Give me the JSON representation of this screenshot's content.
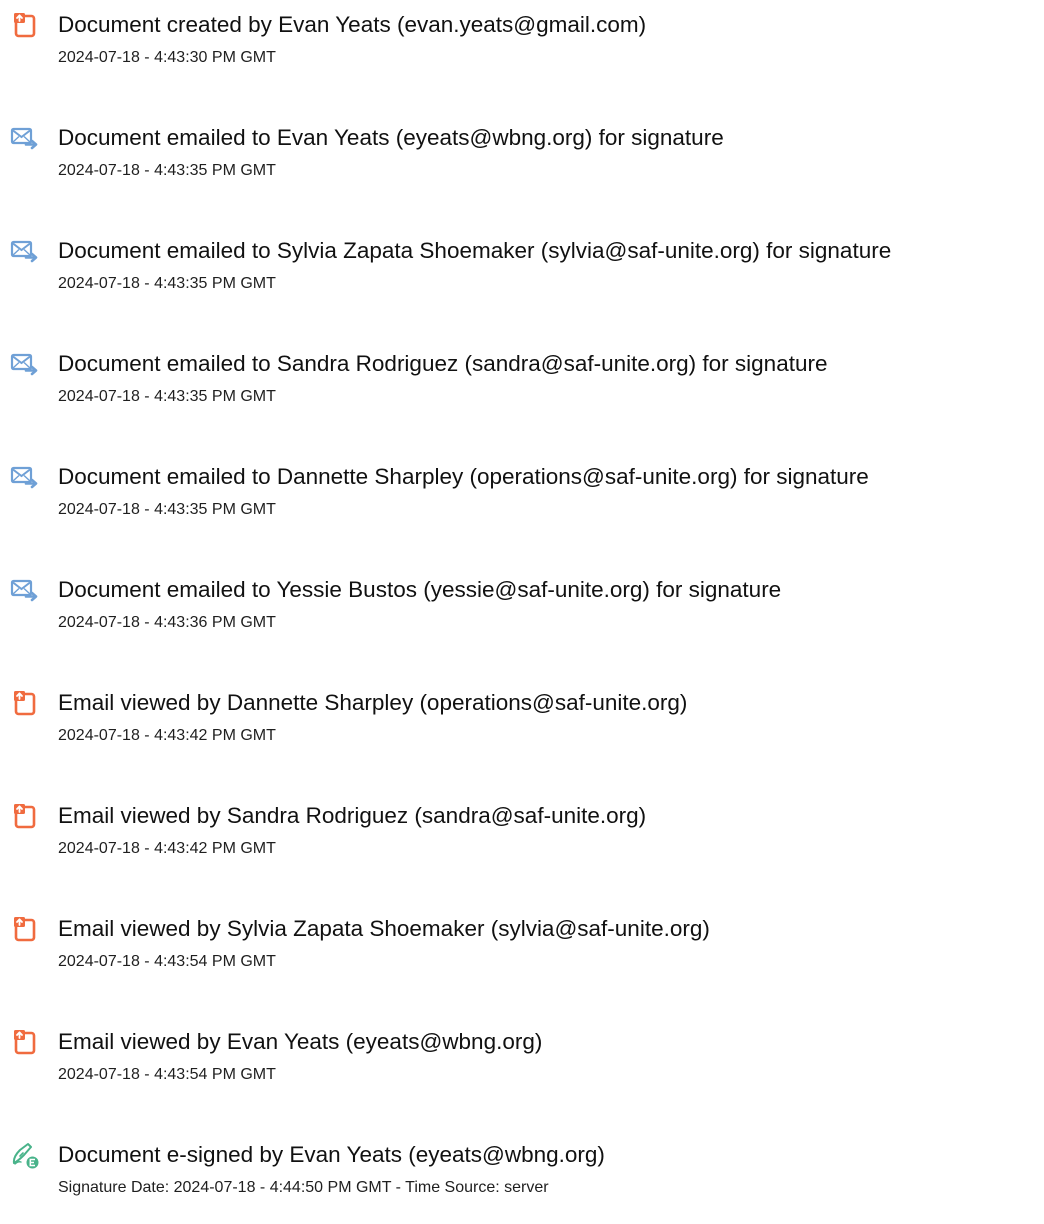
{
  "colors": {
    "doc_icon": "#f06b3f",
    "email_icon": "#6fa0d6",
    "sign_icon": "#49b38a",
    "text": "#111111"
  },
  "events": [
    {
      "icon": "document-icon",
      "title": "Document created by Evan Yeats (evan.yeats@gmail.com)",
      "time": "2024-07-18 - 4:43:30 PM GMT"
    },
    {
      "icon": "email-forward-icon",
      "title": "Document emailed to Evan Yeats (eyeats@wbng.org) for signature",
      "time": "2024-07-18 - 4:43:35 PM GMT"
    },
    {
      "icon": "email-forward-icon",
      "title": "Document emailed to Sylvia Zapata Shoemaker (sylvia@saf-unite.org) for signature",
      "time": "2024-07-18 - 4:43:35 PM GMT"
    },
    {
      "icon": "email-forward-icon",
      "title": "Document emailed to Sandra Rodriguez (sandra@saf-unite.org) for signature",
      "time": "2024-07-18 - 4:43:35 PM GMT"
    },
    {
      "icon": "email-forward-icon",
      "title": "Document emailed to Dannette Sharpley (operations@saf-unite.org) for signature",
      "time": "2024-07-18 - 4:43:35 PM GMT"
    },
    {
      "icon": "email-forward-icon",
      "title": "Document emailed to Yessie Bustos (yessie@saf-unite.org) for signature",
      "time": "2024-07-18 - 4:43:36 PM GMT"
    },
    {
      "icon": "document-icon",
      "title": "Email viewed by Dannette Sharpley (operations@saf-unite.org)",
      "time": "2024-07-18 - 4:43:42 PM GMT"
    },
    {
      "icon": "document-icon",
      "title": "Email viewed by Sandra Rodriguez (sandra@saf-unite.org)",
      "time": "2024-07-18 - 4:43:42 PM GMT"
    },
    {
      "icon": "document-icon",
      "title": "Email viewed by Sylvia Zapata Shoemaker (sylvia@saf-unite.org)",
      "time": "2024-07-18 - 4:43:54 PM GMT"
    },
    {
      "icon": "document-icon",
      "title": "Email viewed by Evan Yeats (eyeats@wbng.org)",
      "time": "2024-07-18 - 4:43:54 PM GMT"
    },
    {
      "icon": "e-sign-pen-icon",
      "title": "Document e-signed by Evan Yeats (eyeats@wbng.org)",
      "time": "Signature Date: 2024-07-18 - 4:44:50 PM GMT - Time Source: server"
    }
  ]
}
